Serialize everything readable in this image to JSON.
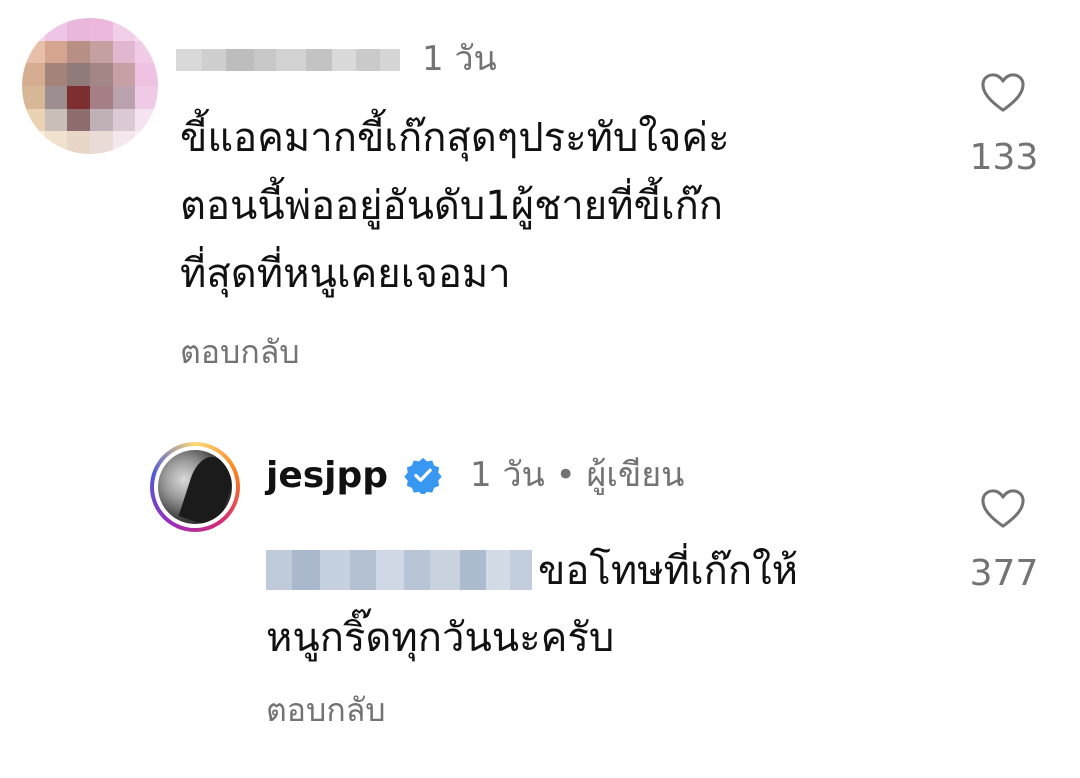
{
  "comment": {
    "timestamp": "1 วัน",
    "text": "ขี้แอคมากขี้เก๊กสุดๆประทับใจค่ะ\nตอนนี้พ่ออยู่อันดับ1ผู้ชายที่ขี้เก๊ก\nที่สุดที่หนูเคยเจอมา",
    "reply_label": "ตอบกลับ",
    "like_count": "133",
    "like_icon": "heart-outline-icon"
  },
  "reply": {
    "username": "jesjpp",
    "verified_icon": "verified-badge-icon",
    "timestamp": "1 วัน",
    "separator": "•",
    "author_label": "ผู้เขียน",
    "text_line1": "ขอโทษที่เก๊กให้",
    "text_line2": "หนูกริ๊ดทุกวันนะครับ",
    "reply_label": "ตอบกลับ",
    "like_count": "377",
    "like_icon": "heart-outline-icon"
  },
  "colors": {
    "text_primary": "#111111",
    "text_secondary": "#737373",
    "verified_blue": "#3897f0"
  }
}
